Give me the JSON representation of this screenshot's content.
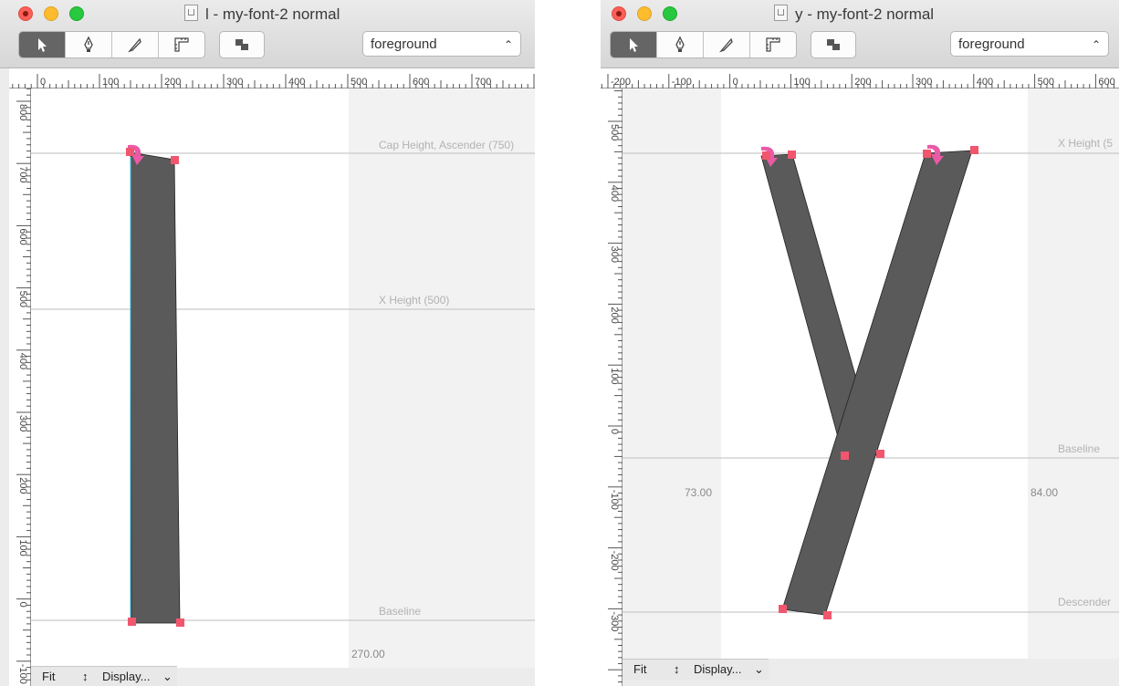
{
  "windows": [
    {
      "title": "l - my-font-2 normal",
      "layer": "foreground",
      "ruler_h_labels": [
        "0",
        "100",
        "200",
        "300",
        "400",
        "500",
        "600",
        "700"
      ],
      "ruler_v_labels": [
        "800",
        "700",
        "600",
        "500",
        "400",
        "300",
        "200",
        "100",
        "0",
        "-100"
      ],
      "guides": {
        "cap": "Cap Height, Ascender (750)",
        "xheight": "X Height (500)",
        "baseline": "Baseline"
      },
      "advance": "270.00",
      "zoom": "Fit",
      "display": "Display..."
    },
    {
      "title": "y - my-font-2 normal",
      "layer": "foreground",
      "ruler_h_labels": [
        "-200",
        "-100",
        "0",
        "100",
        "200",
        "300",
        "400",
        "500",
        "600"
      ],
      "ruler_v_labels": [
        "500",
        "400",
        "300",
        "200",
        "100",
        "0",
        "-100",
        "-200",
        "-300"
      ],
      "guides": {
        "xheight": "X Height (5",
        "baseline": "Baseline",
        "descender": "Descender"
      },
      "left_sidebearing": "73.00",
      "right_sidebearing": "84.00",
      "zoom": "Fit",
      "display": "Display..."
    }
  ],
  "colors": {
    "glyph": "#5a5a5a",
    "point": "#f2566e",
    "arrow": "#ea5aa6",
    "guide": "#bdbdbd",
    "margin": "#f2f2f2"
  },
  "icons": [
    "pointer-icon",
    "pen-icon",
    "knife-icon",
    "ruler-icon",
    "layers-icon",
    "chevron-updown-icon"
  ]
}
